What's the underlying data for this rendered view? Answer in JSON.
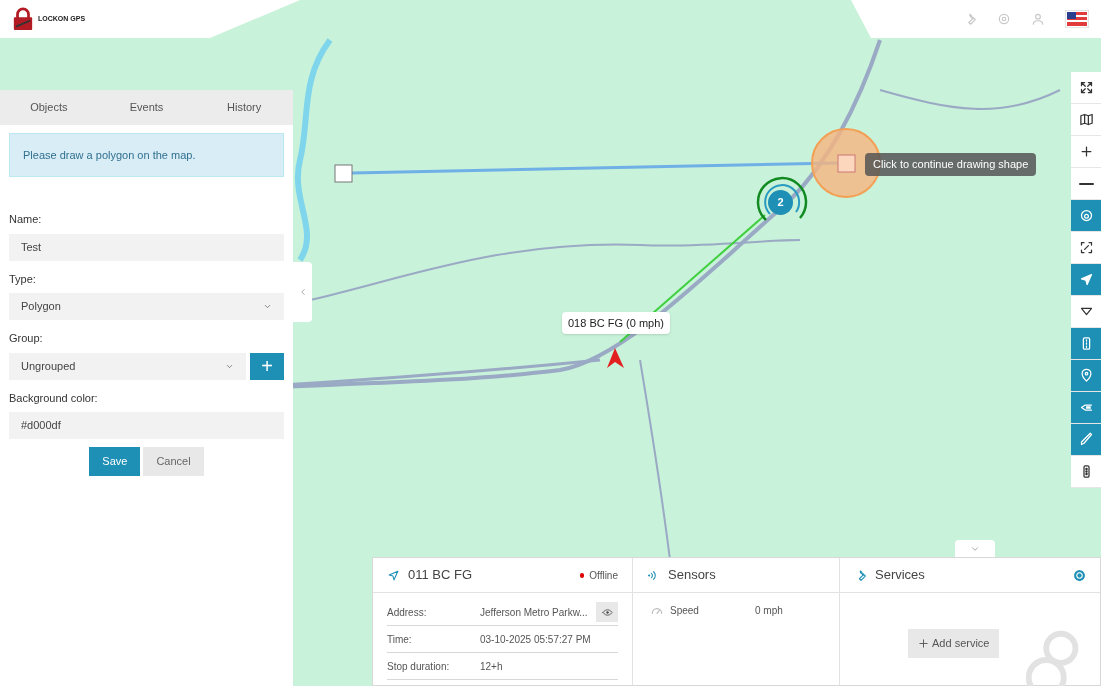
{
  "header": {
    "logo_text": "LOCKON GPS"
  },
  "sidebar": {
    "tabs": [
      {
        "label": "Objects",
        "selected": false
      },
      {
        "label": "Events",
        "selected": false
      },
      {
        "label": "History",
        "selected": false
      }
    ],
    "alert": "Please draw a polygon on the map.",
    "fields": [
      {
        "kind": "text",
        "label": "Name:",
        "value": "Test"
      },
      {
        "kind": "select",
        "label": "Type:",
        "value": "Polygon"
      },
      {
        "kind": "select_add",
        "label": "Group:",
        "value": "Ungrouped",
        "button": "+"
      },
      {
        "kind": "text",
        "label": "Background color:",
        "value": "#d000df"
      }
    ],
    "buttons": [
      {
        "label": "Save",
        "kind": "primary"
      },
      {
        "label": "Cancel",
        "kind": "secondary"
      }
    ]
  },
  "map": {
    "drawing_hint": "Click to continue drawing shape",
    "cluster_count": "2",
    "vehicle_label": "018 BC FG (0 mph)"
  },
  "map_tools": [
    {
      "kind": "fullscreen",
      "selected": false
    },
    {
      "kind": "layers",
      "selected": false
    },
    {
      "kind": "zoom_in",
      "selected": false
    },
    {
      "kind": "zoom_out",
      "selected": false
    },
    {
      "kind": "gauge",
      "selected": true
    },
    {
      "kind": "focus",
      "selected": false
    },
    {
      "kind": "navigate",
      "selected": true
    },
    {
      "kind": "route",
      "selected": false
    },
    {
      "kind": "road",
      "selected": true
    },
    {
      "kind": "pin",
      "selected": true
    },
    {
      "kind": "back",
      "selected": true
    },
    {
      "kind": "pen",
      "selected": true
    },
    {
      "kind": "traffic",
      "selected": false
    }
  ],
  "details": {
    "object": {
      "name": "011 BC FG",
      "status": "Offline",
      "color": "#e00000",
      "rows": [
        {
          "label": "Address:",
          "value": "Jefferson Metro Parkw...",
          "eye": true
        },
        {
          "label": "Time:",
          "value": "03-10-2025 05:57:27 PM",
          "eye": false
        },
        {
          "label": "Stop duration:",
          "value": "12+h",
          "eye": false
        }
      ]
    },
    "sensors": {
      "title": "Sensors",
      "rows": [
        {
          "name": "Speed",
          "value": "0 mph"
        }
      ]
    },
    "services": {
      "title": "Services",
      "button": "Add service"
    }
  }
}
